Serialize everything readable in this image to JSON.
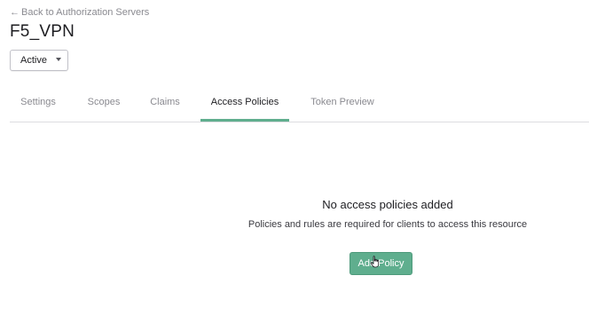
{
  "header": {
    "back_arrow": "←",
    "back_label": "Back to Authorization Servers",
    "title": "F5_VPN"
  },
  "status_dropdown": {
    "selected": "Active"
  },
  "tabs": [
    {
      "label": "Settings",
      "active": false
    },
    {
      "label": "Scopes",
      "active": false
    },
    {
      "label": "Claims",
      "active": false
    },
    {
      "label": "Access Policies",
      "active": true
    },
    {
      "label": "Token Preview",
      "active": false
    }
  ],
  "empty_state": {
    "title": "No access policies added",
    "description": "Policies and rules are required for clients to access this resource",
    "button_label": "Add Policy"
  },
  "colors": {
    "accent": "#5fae8e",
    "muted_text": "#8a8a90",
    "text": "#1d1d21",
    "divider": "#dcdce0"
  },
  "icons": {
    "cursor": "hand-pointer-icon",
    "caret": "caret-down-icon",
    "back": "arrow-left-icon"
  }
}
